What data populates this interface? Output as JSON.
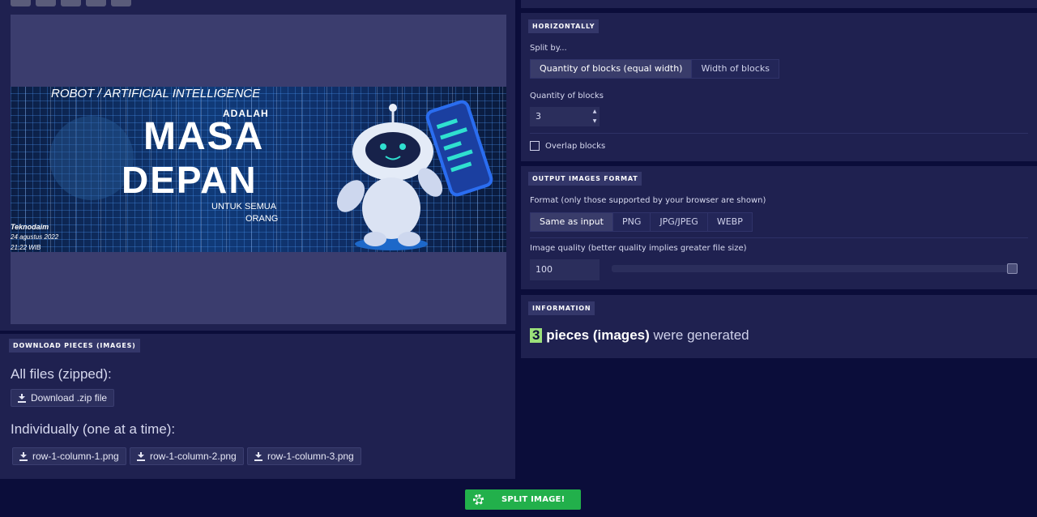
{
  "preview": {
    "zoom_buttons": [
      "zoom-in",
      "zoom-out",
      "zoom-fit",
      "zoom-reset",
      "more"
    ],
    "banner": {
      "top_line": "ROBOT / ARTIFICIAL INTELLIGENCE",
      "adalah": "ADALAH",
      "masa": "MASA",
      "depan": "DEPAN",
      "untuk": "UNTUK SEMUA",
      "orang": "ORANG",
      "author": "Teknodaim",
      "date": "24 agustus 2022",
      "time": "21:22 WIB"
    }
  },
  "download": {
    "badge": "DOWNLOAD PIECES (IMAGES)",
    "all_files_title": "All files (zipped):",
    "zip_button": "Download .zip file",
    "individual_title": "Individually (one at a time):",
    "files": [
      "row-1-column-1.png",
      "row-1-column-2.png",
      "row-1-column-3.png"
    ]
  },
  "horizontally": {
    "badge": "HORIZONTALLY",
    "split_by_label": "Split by...",
    "split_options": [
      "Quantity of blocks (equal width)",
      "Width of blocks"
    ],
    "selected_option": "Quantity of blocks (equal width)",
    "quantity_label": "Quantity of blocks",
    "quantity_value": "3",
    "overlap_label": "Overlap blocks",
    "overlap_checked": false
  },
  "output_format": {
    "badge": "OUTPUT IMAGES FORMAT",
    "format_label": "Format (only those supported by your browser are shown)",
    "formats": [
      "Same as input",
      "PNG",
      "JPG/JPEG",
      "WEBP"
    ],
    "selected_format": "Same as input",
    "quality_label": "Image quality (better quality implies greater file size)",
    "quality_value": "100",
    "quality_fraction": 1.0
  },
  "information": {
    "badge": "INFORMATION",
    "count": "3",
    "bold_text": "pieces (images)",
    "rest_text": "were generated"
  },
  "split_button": {
    "label": "SPLIT IMAGE!",
    "icon": "gear-icon"
  },
  "colors": {
    "background": "#0b0d3a",
    "panel": "#1f2150",
    "accent_green": "#22b04b",
    "count_highlight": "#9be07a"
  }
}
